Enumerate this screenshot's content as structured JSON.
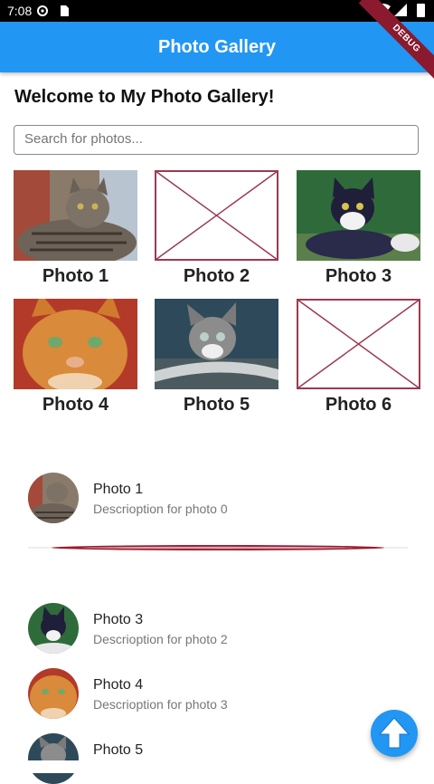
{
  "status_bar": {
    "time": "7:08"
  },
  "app_bar": {
    "title": "Photo Gallery",
    "debug_badge": "DEBUG",
    "color": "#2196F3"
  },
  "welcome": "Welcome to My Photo Gallery!",
  "search": {
    "placeholder": "Search for photos...",
    "value": ""
  },
  "grid": [
    {
      "caption": "Photo 1",
      "image": "tabby-cat",
      "loaded": true
    },
    {
      "caption": "Photo 2",
      "image": "placeholder",
      "loaded": false
    },
    {
      "caption": "Photo 3",
      "image": "tuxedo-cat",
      "loaded": true
    },
    {
      "caption": "Photo 4",
      "image": "orange-cat",
      "loaded": true
    },
    {
      "caption": "Photo 5",
      "image": "kitten",
      "loaded": true
    },
    {
      "caption": "Photo 6",
      "image": "placeholder",
      "loaded": false
    }
  ],
  "list": [
    {
      "title": "Photo 1",
      "subtitle": "Descrioption for photo 0",
      "image": "tabby-cat"
    },
    {
      "title": "Photo 3",
      "subtitle": "Descrioption for photo 2",
      "image": "tuxedo-cat"
    },
    {
      "title": "Photo 4",
      "subtitle": "Descrioption for photo 3",
      "image": "orange-cat"
    },
    {
      "title": "Photo 5",
      "subtitle": "",
      "image": "kitten"
    }
  ],
  "fab": {
    "icon": "arrow-up-icon"
  },
  "colors": {
    "placeholder_stroke": "#9B3A50",
    "divider": "#9B1B30"
  }
}
